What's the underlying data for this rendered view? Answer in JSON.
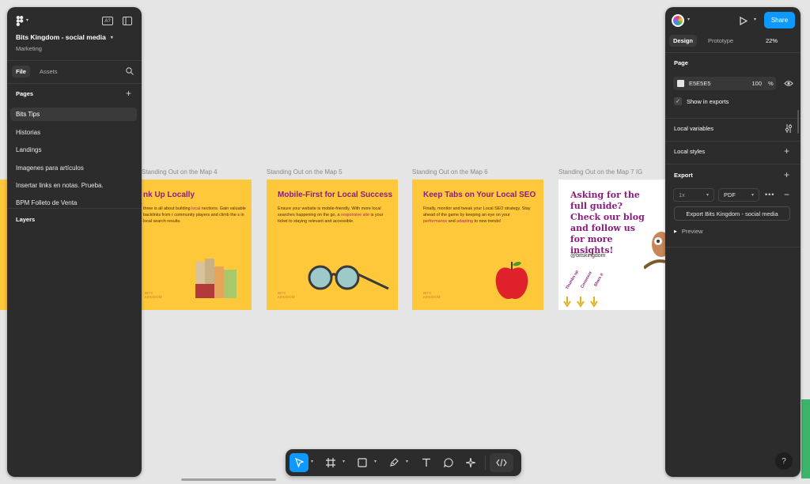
{
  "left_panel": {
    "file_name": "Bits Kingdom - social media",
    "project": "Marketing",
    "tabs": [
      "File",
      "Assets"
    ],
    "pages_heading": "Pages",
    "pages": [
      "Bits Tips",
      "Historias",
      "Landings",
      "Imagenes para artículos",
      "Insertar links en notas. Prueba.",
      "BPM Folleto de Venta"
    ],
    "layers_heading": "Layers",
    "ai_badge": "A?"
  },
  "canvas": {
    "frames": [
      {
        "label": "Standing Out on the Map 4",
        "title": "nk Up Locally",
        "body_pre": " three is all about building ",
        "body_hl": "local",
        "body_rest": " nections. Gain valuable backlinks from r community players and climb the s in local search results."
      },
      {
        "label": "Standing Out on the Map 5",
        "title": "Mobile-First for Local Success",
        "body_pre": "Ensure your website is mobile-friendly. With more local searches happening on the go, a ",
        "body_hl": "responsive site",
        "body_rest": " is your ticket to staying relevant and accessible."
      },
      {
        "label": "Standing Out on the Map 6",
        "title": "Keep Tabs on Your Local SEO",
        "body_pre": "Finally, monitor and tweak your Local SEO strategy. Stay ahead of the game by keeping an eye on your ",
        "body_hl": "performance",
        "body_mid": " and ",
        "body_hl2": "adapting",
        "body_rest": " to new trends!"
      },
      {
        "label": "Standing Out on the Map 7 IG",
        "title": "Asking for the full guide? Check our blog and follow us for more insights!",
        "handle": "@bitskingdom",
        "reactions": [
          "Thumbs up",
          "Comment",
          "Share it"
        ]
      }
    ],
    "logo_text": "BITS KINGDOM"
  },
  "right_panel": {
    "tabs": [
      "Design",
      "Prototype"
    ],
    "zoom": "22%",
    "share_label": "Share",
    "page_heading": "Page",
    "bg_color_hex": "E5E5E5",
    "bg_opacity": "100",
    "percent": "%",
    "show_in_exports": "Show in exports",
    "local_variables": "Local variables",
    "local_styles": "Local styles",
    "export_heading": "Export",
    "export_scale": "1x",
    "export_format": "PDF",
    "export_button": "Export Bits Kingdom - social media",
    "preview_label": "Preview",
    "help": "?"
  },
  "colors": {
    "panel_bg": "#2c2c2c",
    "canvas_bg": "#e5e5e5",
    "accent": "#0d99ff",
    "frame_yellow": "#ffc83a",
    "frame_purple": "#8a1c7c"
  }
}
